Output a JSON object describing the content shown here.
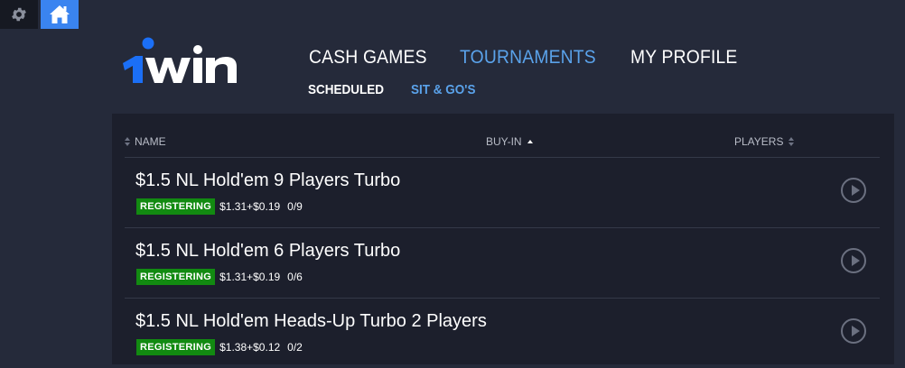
{
  "topbar": {
    "settings_icon": "gear-icon",
    "home_icon": "home-icon"
  },
  "logo": {
    "text": "1win",
    "colors": {
      "one": "#1b6ff6",
      "win": "#ffffff"
    }
  },
  "main_nav": [
    {
      "label": "CASH GAMES",
      "active": false
    },
    {
      "label": "TOURNAMENTS",
      "active": true
    },
    {
      "label": "MY PROFILE",
      "active": false
    }
  ],
  "sub_nav": [
    {
      "label": "SCHEDULED",
      "active": false
    },
    {
      "label": "SIT & GO'S",
      "active": true
    }
  ],
  "table": {
    "columns": {
      "name": "NAME",
      "buyin": "BUY-IN",
      "players": "PLAYERS"
    },
    "sorted_by": "BUY-IN",
    "rows": [
      {
        "title": "$1.5 NL Hold'em 9 Players Turbo",
        "status": "REGISTERING",
        "buyin": "$1.31+$0.19",
        "players": "0/9"
      },
      {
        "title": "$1.5 NL Hold'em 6 Players Turbo",
        "status": "REGISTERING",
        "buyin": "$1.31+$0.19",
        "players": "0/6"
      },
      {
        "title": "$1.5 NL Hold'em Heads-Up Turbo 2 Players",
        "status": "REGISTERING",
        "buyin": "$1.38+$0.12",
        "players": "0/2"
      }
    ]
  },
  "colors": {
    "background": "#252a3a",
    "panel": "#1c1f2c",
    "accent": "#5aa2ea",
    "status_green": "#128a11",
    "home_blue": "#3a84f0"
  }
}
